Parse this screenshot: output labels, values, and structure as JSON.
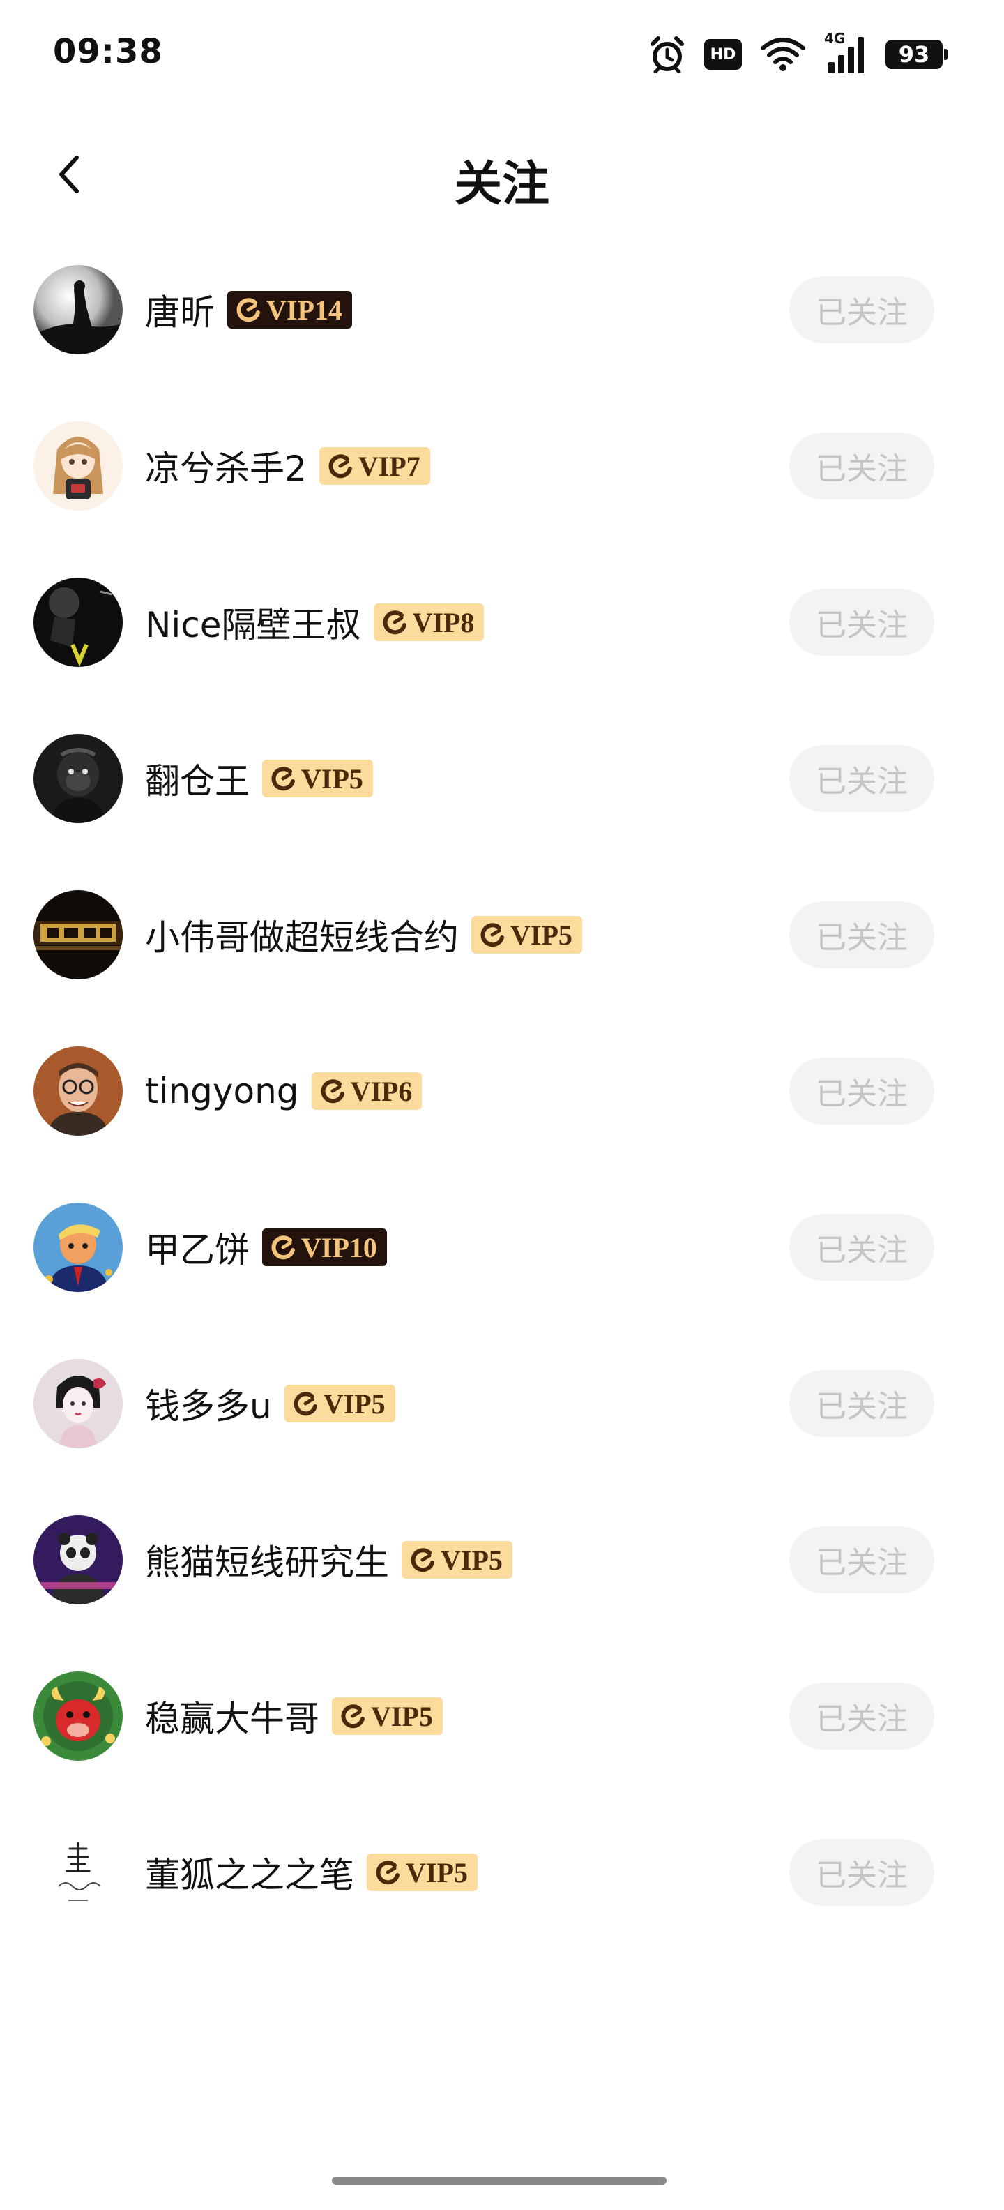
{
  "status_bar": {
    "time": "09:38",
    "hd": "HD",
    "network": "4G",
    "battery": "93"
  },
  "header": {
    "title": "关注"
  },
  "users": [
    {
      "name": "唐昕",
      "vip": "VIP14",
      "vip_style": "dark",
      "button": "已关注",
      "avatar": "silhouette"
    },
    {
      "name": "凉兮杀手2",
      "vip": "VIP7",
      "vip_style": "light",
      "button": "已关注",
      "avatar": "anime-girl"
    },
    {
      "name": "Nice隔壁王叔",
      "vip": "VIP8",
      "vip_style": "light",
      "button": "已关注",
      "avatar": "dark-logo"
    },
    {
      "name": "翻仓王",
      "vip": "VIP5",
      "vip_style": "light",
      "button": "已关注",
      "avatar": "ape"
    },
    {
      "name": "小伟哥做超短线合约",
      "vip": "VIP5",
      "vip_style": "light",
      "button": "已关注",
      "avatar": "banner"
    },
    {
      "name": "tingyong",
      "vip": "VIP6",
      "vip_style": "light",
      "button": "已关注",
      "avatar": "man-glasses"
    },
    {
      "name": "甲乙饼",
      "vip": "VIP10",
      "vip_style": "dark",
      "button": "已关注",
      "avatar": "cartoon-man"
    },
    {
      "name": "钱多多u",
      "vip": "VIP5",
      "vip_style": "light",
      "button": "已关注",
      "avatar": "geisha"
    },
    {
      "name": "熊猫短线研究生",
      "vip": "VIP5",
      "vip_style": "light",
      "button": "已关注",
      "avatar": "panda"
    },
    {
      "name": "稳赢大牛哥",
      "vip": "VIP5",
      "vip_style": "light",
      "button": "已关注",
      "avatar": "red-bull"
    },
    {
      "name": "董狐之之之笔",
      "vip": "VIP5",
      "vip_style": "light",
      "button": "已关注",
      "avatar": "calligraphy"
    }
  ],
  "colors": {
    "vip_light_bg": "#fbdc9c",
    "vip_dark_bg": "#24120c",
    "button_bg": "#f3f3f3",
    "button_text": "#c4c4c4"
  }
}
